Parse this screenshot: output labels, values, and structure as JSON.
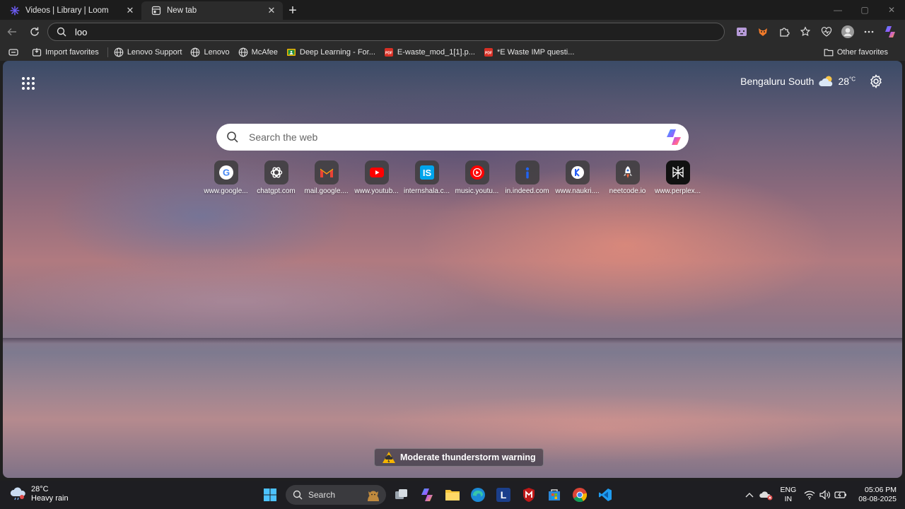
{
  "tabs": [
    {
      "title": "Videos | Library | Loom",
      "active": false
    },
    {
      "title": "New tab",
      "active": true
    }
  ],
  "address_bar": {
    "value": "loo"
  },
  "favorites": [
    {
      "label": "Import favorites",
      "icon": "import-icon"
    },
    {
      "label": "Lenovo Support",
      "icon": "globe-icon"
    },
    {
      "label": "Lenovo",
      "icon": "globe-icon"
    },
    {
      "label": "McAfee",
      "icon": "globe-icon"
    },
    {
      "label": "Deep Learning - For...",
      "icon": "classroom-icon"
    },
    {
      "label": "E-waste_mod_1[1].p...",
      "icon": "pdf-icon"
    },
    {
      "label": "*E Waste IMP questi...",
      "icon": "pdf-icon"
    }
  ],
  "other_favorites": "Other favorites",
  "weather": {
    "location": "Bengaluru South",
    "temp": "28",
    "unit": "°C"
  },
  "search": {
    "placeholder": "Search the web"
  },
  "quick_links": [
    {
      "label": "www.google...",
      "icon": "google-icon"
    },
    {
      "label": "chatgpt.com",
      "icon": "chatgpt-icon"
    },
    {
      "label": "mail.google....",
      "icon": "gmail-icon"
    },
    {
      "label": "www.youtub...",
      "icon": "youtube-icon"
    },
    {
      "label": "internshala.c...",
      "icon": "internshala-icon"
    },
    {
      "label": "music.youtu...",
      "icon": "youtube-music-icon"
    },
    {
      "label": "in.indeed.com",
      "icon": "indeed-icon"
    },
    {
      "label": "www.naukri....",
      "icon": "naukri-icon"
    },
    {
      "label": "neetcode.io",
      "icon": "neetcode-icon"
    },
    {
      "label": "www.perplex...",
      "icon": "perplexity-icon"
    }
  ],
  "alert": "Moderate thunderstorm warning",
  "taskbar": {
    "weather_temp": "28°C",
    "weather_desc": "Heavy rain",
    "search_label": "Search",
    "lang1": "ENG",
    "lang2": "IN",
    "time": "05:06 PM",
    "date": "08-08-2025"
  }
}
